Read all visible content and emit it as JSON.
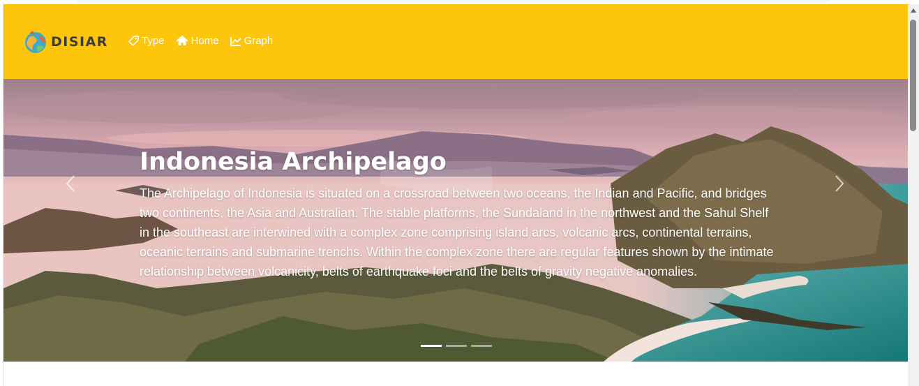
{
  "brand": {
    "name": "DISIAR",
    "logo_icon": "globe-logo-icon"
  },
  "nav": {
    "items": [
      {
        "label": "Type",
        "icon": "tag-icon"
      },
      {
        "label": "Home",
        "icon": "home-icon"
      },
      {
        "label": "Graph",
        "icon": "line-chart-icon"
      }
    ]
  },
  "hero": {
    "title": "Indonesia Archipelago",
    "text": "The Archipelago of Indonesia is situated on a crossroad between two oceans, the Indian and Pacific, and bridges two continents, the Asia and Australian. The stable platforms, the Sundaland in the northwest and the Sahul Shelf in the southeast are interwined with a complex zone comprising island arcs, volcanic arcs, continental terrains, oceanic terrains and submarine trenchs. Within the complex zone there are regular features shown by the intimate relationship between volcanicity, belts of earthquake foci and the belts of gravity negative anomalies.",
    "slide_count": 3,
    "active_slide": 1
  },
  "colors": {
    "navbar": "#fdc50b",
    "nav_text": "#ffffff",
    "brand_text": "#3b3b3b"
  }
}
